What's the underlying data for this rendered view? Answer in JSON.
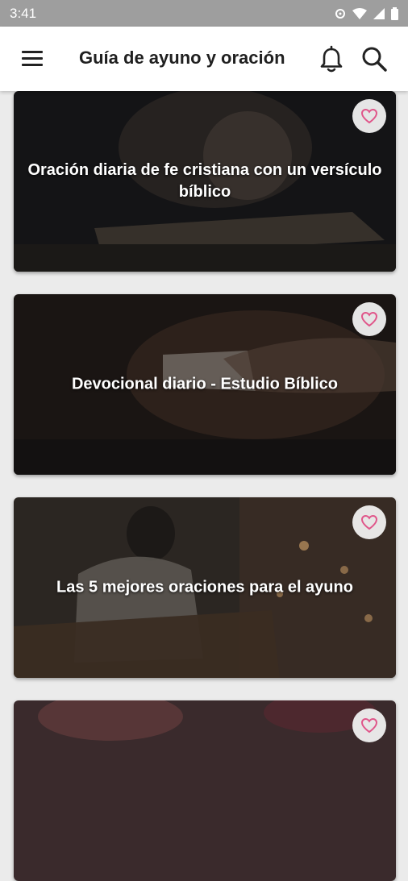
{
  "status_bar": {
    "time": "3:41"
  },
  "app_bar": {
    "title": "Guía de ayuno y oración"
  },
  "colors": {
    "heart": "#e0568a",
    "appbar": "#ffffff",
    "statusbar": "#9e9e9e"
  },
  "cards": [
    {
      "title": "Oración diaria de fe cristiana con un versículo bíblico"
    },
    {
      "title": "Devocional diario - Estudio Bíblico"
    },
    {
      "title": "Las 5 mejores oraciones para el ayuno"
    },
    {
      "title": ""
    }
  ]
}
